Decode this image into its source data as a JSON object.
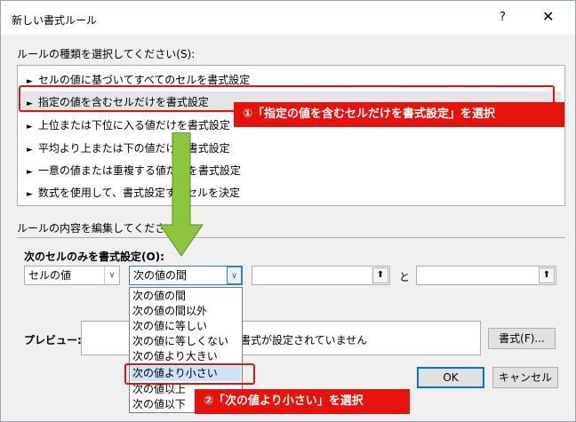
{
  "window": {
    "title": "新しい書式ルール",
    "help": "?",
    "close": "✕"
  },
  "rule_type": {
    "label": "ルールの種類を選択してください(S):",
    "items": [
      "セルの値に基づいてすべてのセルを書式設定",
      "指定の値を含むセルだけを書式設定",
      "上位または下位に入る値だけを書式設定",
      "平均より上または下の値だけを書式設定",
      "一意の値または重複する値だけを書式設定",
      "数式を使用して、書式設定するセルを決定"
    ],
    "selected_index": 1,
    "bullet": "►"
  },
  "edit": {
    "label": "ルールの内容を編集してください(E):",
    "format_only_label": "次のセルのみを書式設定(O):",
    "combo1": "セルの値",
    "combo2": "次の値の間",
    "to_label": "と",
    "ref_icon": "⬆",
    "dropdown_arrow": "∨",
    "operator_options": [
      "次の値の間",
      "次の値の間以外",
      "次の値に等しい",
      "次の値に等しくない",
      "次の値より大きい",
      "次の値より小さい",
      "次の値以上",
      "次の値以下"
    ],
    "highlighted_option_index": 5
  },
  "preview": {
    "label": "プレビュー:",
    "text": "書式が設定されていません",
    "format_button": "書式(F)..."
  },
  "buttons": {
    "ok": "OK",
    "cancel": "キャンセル"
  },
  "annotations": {
    "step1": "①「指定の値を含むセルだけを書式設定」を選択",
    "step2": "②「次の値より小さい」を選択"
  },
  "colors": {
    "accent_red": "#e8120c",
    "arrow_green": "#8cc63f",
    "highlight_blue": "#cce4f7"
  }
}
